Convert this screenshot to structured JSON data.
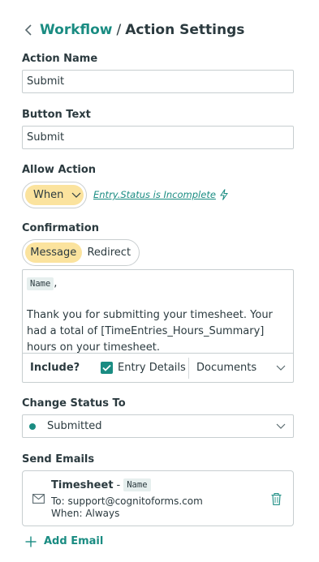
{
  "header": {
    "breadcrumb_link": "Workflow",
    "separator": "/",
    "title": "Action Settings",
    "back_icon": "chevron-left-icon"
  },
  "action_name": {
    "label": "Action Name",
    "value": "Submit"
  },
  "button_text": {
    "label": "Button Text",
    "value": "Submit"
  },
  "allow_action": {
    "label": "Allow Action",
    "selected": "When",
    "condition": "Entry.Status is Incomplete",
    "condition_icon": "lightning-bolt-icon"
  },
  "confirmation": {
    "label": "Confirmation",
    "options": [
      "Message",
      "Redirect"
    ],
    "active": "Message",
    "message_token": "Name",
    "message_after_token": ",",
    "message_body": "Thank you for submitting your timesheet.  Your had a total of [TimeEntries_Hours_Summary] hours on your timesheet.",
    "include_label": "Include?",
    "entry_details_label": "Entry Details",
    "entry_details_checked": true,
    "documents_label": "Documents"
  },
  "change_status": {
    "label": "Change Status To",
    "value": "Submitted"
  },
  "send_emails": {
    "label": "Send Emails",
    "emails": [
      {
        "title": "Timesheet",
        "dash": "-",
        "token": "Name",
        "to": "To: support@cognitoforms.com",
        "when": "When: Always"
      }
    ],
    "add_label": "Add Email"
  },
  "colors": {
    "accent": "#1a8c82",
    "highlight": "#fbe39e",
    "text": "#2b3a3f",
    "border": "#c7ced0"
  }
}
